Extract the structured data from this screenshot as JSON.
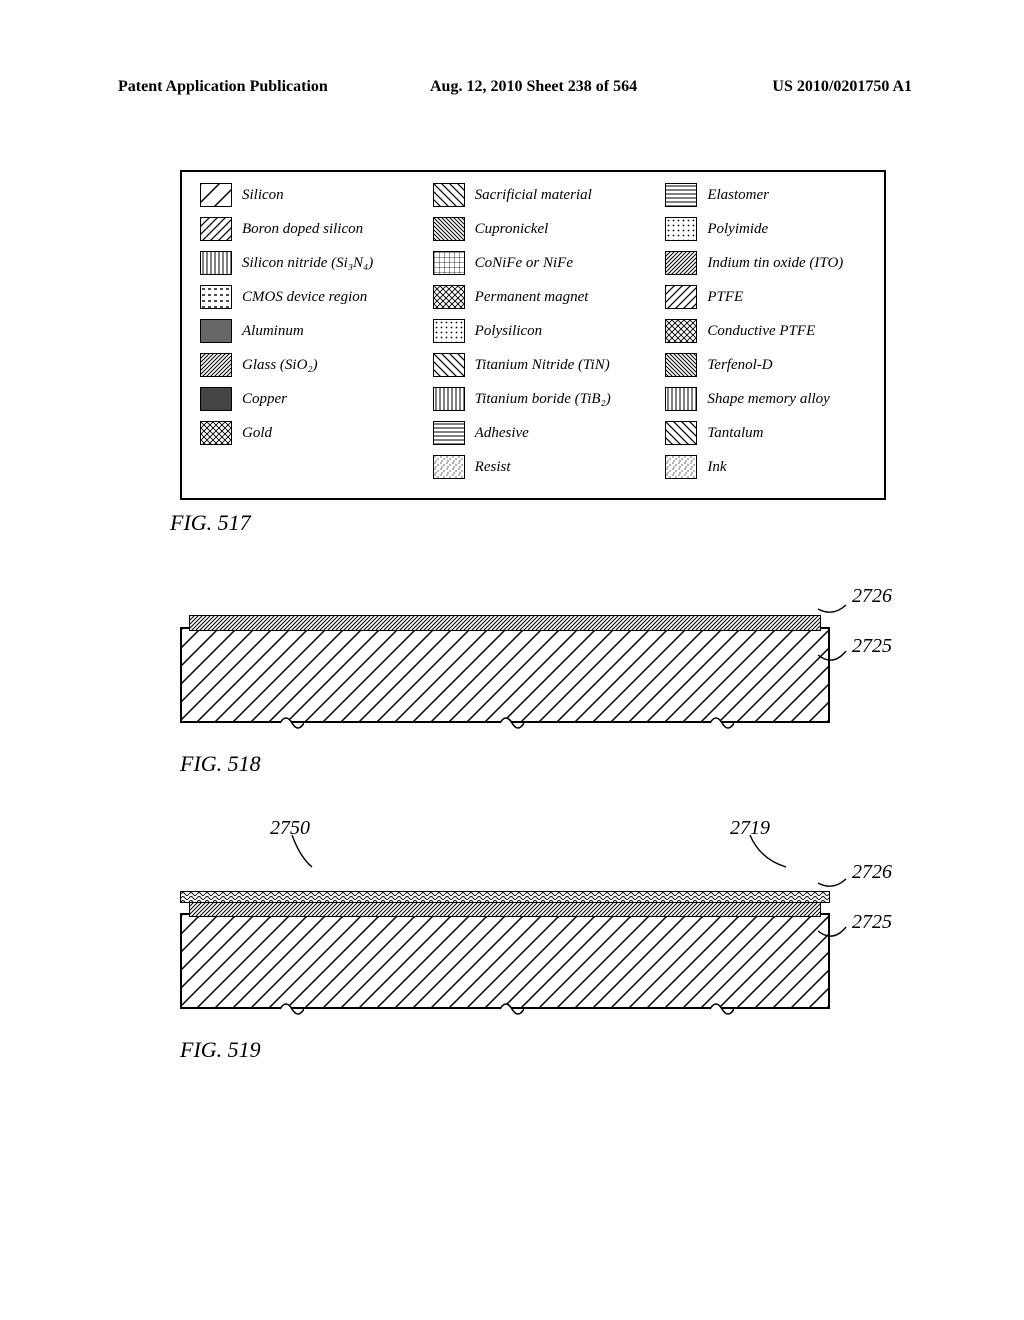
{
  "header": {
    "left": "Patent Application Publication",
    "center": "Aug. 12, 2010  Sheet 238 of 564",
    "right": "US 2010/0201750 A1"
  },
  "legend": {
    "col1": [
      {
        "name": "silicon",
        "label": "Silicon"
      },
      {
        "name": "boron-doped-silicon",
        "label": "Boron doped silicon"
      },
      {
        "name": "silicon-nitride",
        "label": "Silicon nitride (Si₃N₄)"
      },
      {
        "name": "cmos-device-region",
        "label": "CMOS device region"
      },
      {
        "name": "aluminum",
        "label": "Aluminum"
      },
      {
        "name": "glass",
        "label": "Glass (SiO₂)"
      },
      {
        "name": "copper",
        "label": "Copper"
      },
      {
        "name": "gold",
        "label": "Gold"
      }
    ],
    "col2": [
      {
        "name": "sacrificial-material",
        "label": "Sacrificial material"
      },
      {
        "name": "cupronickel",
        "label": "Cupronickel"
      },
      {
        "name": "conife-nife",
        "label": "CoNiFe or NiFe"
      },
      {
        "name": "permanent-magnet",
        "label": "Permanent magnet"
      },
      {
        "name": "polysilicon",
        "label": "Polysilicon"
      },
      {
        "name": "titanium-nitride",
        "label": "Titanium Nitride (TiN)"
      },
      {
        "name": "titanium-boride",
        "label": "Titanium boride (TiB₂)"
      },
      {
        "name": "adhesive",
        "label": "Adhesive"
      },
      {
        "name": "resist",
        "label": "Resist"
      }
    ],
    "col3": [
      {
        "name": "elastomer",
        "label": "Elastomer"
      },
      {
        "name": "polyimide",
        "label": "Polyimide"
      },
      {
        "name": "ito",
        "label": "Indium tin oxide (ITO)"
      },
      {
        "name": "ptfe",
        "label": "PTFE"
      },
      {
        "name": "conductive-ptfe",
        "label": "Conductive PTFE"
      },
      {
        "name": "terfenol-d",
        "label": "Terfenol-D"
      },
      {
        "name": "shape-memory-alloy",
        "label": "Shape memory alloy"
      },
      {
        "name": "tantalum",
        "label": "Tantalum"
      },
      {
        "name": "ink",
        "label": "Ink"
      }
    ]
  },
  "figures": {
    "517": {
      "caption": "FIG. 517"
    },
    "518": {
      "caption": "FIG. 518",
      "labels": {
        "2725": "2725",
        "2726": "2726"
      }
    },
    "519": {
      "caption": "FIG. 519",
      "labels": {
        "2725": "2725",
        "2726": "2726",
        "2719": "2719",
        "2750": "2750"
      }
    }
  }
}
